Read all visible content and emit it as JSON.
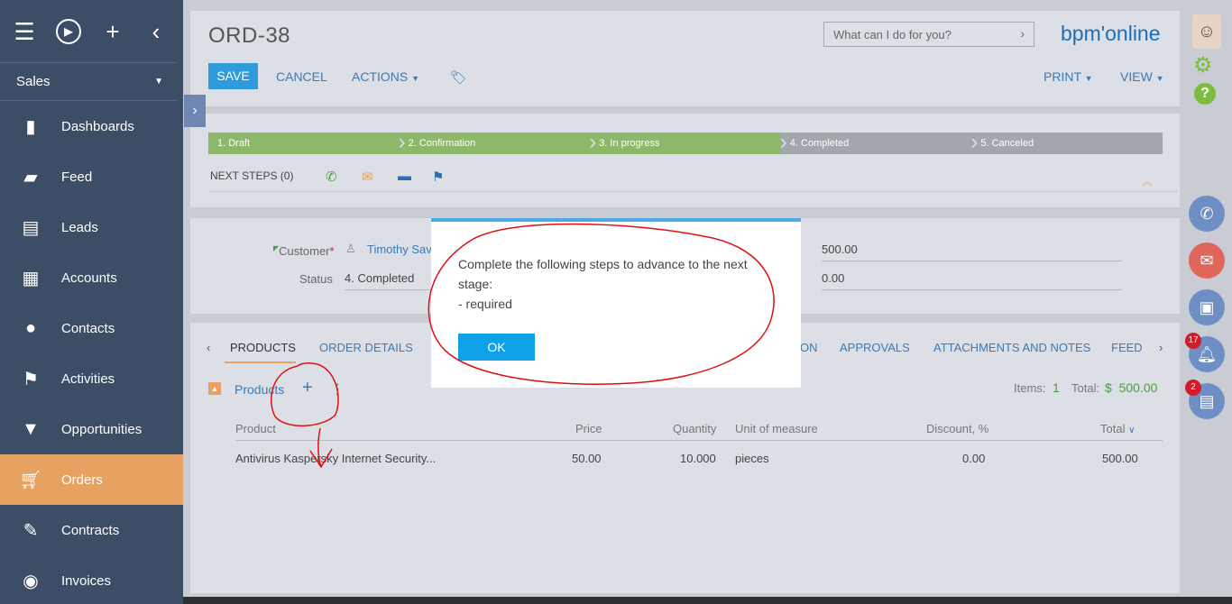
{
  "sidebar": {
    "workspace": "Sales",
    "items": [
      {
        "label": "Dashboards",
        "icon": "dashboards-icon"
      },
      {
        "label": "Feed",
        "icon": "feed-icon"
      },
      {
        "label": "Leads",
        "icon": "leads-icon"
      },
      {
        "label": "Accounts",
        "icon": "accounts-icon"
      },
      {
        "label": "Contacts",
        "icon": "contacts-icon"
      },
      {
        "label": "Activities",
        "icon": "activities-icon"
      },
      {
        "label": "Opportunities",
        "icon": "opportunities-icon"
      },
      {
        "label": "Orders",
        "icon": "orders-icon",
        "active": true
      },
      {
        "label": "Contracts",
        "icon": "contracts-icon"
      },
      {
        "label": "Invoices",
        "icon": "invoices-icon"
      }
    ]
  },
  "header": {
    "title": "ORD-38",
    "search_placeholder": "What can I do for you?",
    "logo": "bpm'online",
    "save": "SAVE",
    "cancel": "CANCEL",
    "actions": "ACTIONS",
    "print": "PRINT",
    "view": "VIEW"
  },
  "stages": [
    "1. Draft",
    "2. Confirmation",
    "3. In progress",
    "4. Completed",
    "5. Canceled"
  ],
  "next_steps": "NEXT STEPS (0)",
  "fields": {
    "customer_label": "Customer",
    "customer_value": "Timothy Sav",
    "status_label": "Status",
    "status_value": "4. Completed",
    "amount": "500.00",
    "payment": "0.00"
  },
  "tabs": [
    "PRODUCTS",
    "ORDER DETAILS",
    "ON",
    "APPROVALS",
    "ATTACHMENTS AND NOTES",
    "FEED"
  ],
  "products": {
    "title": "Products",
    "items_label": "Items:",
    "items_count": "1",
    "total_label": "Total:",
    "total_value": "$  500.00",
    "columns": [
      "Product",
      "Price",
      "Quantity",
      "Unit of measure",
      "Discount, %",
      "Total"
    ],
    "rows": [
      [
        "Antivirus Kaspersky Internet Security...",
        "50.00",
        "10.000",
        "pieces",
        "0.00",
        "500.00"
      ]
    ]
  },
  "dialog": {
    "line1": "Complete the following steps to advance to the next",
    "line2": "stage:",
    "line3": "- required",
    "ok": "OK"
  },
  "rightbar": {
    "notifications_badge": "17",
    "process_badge": "2"
  }
}
